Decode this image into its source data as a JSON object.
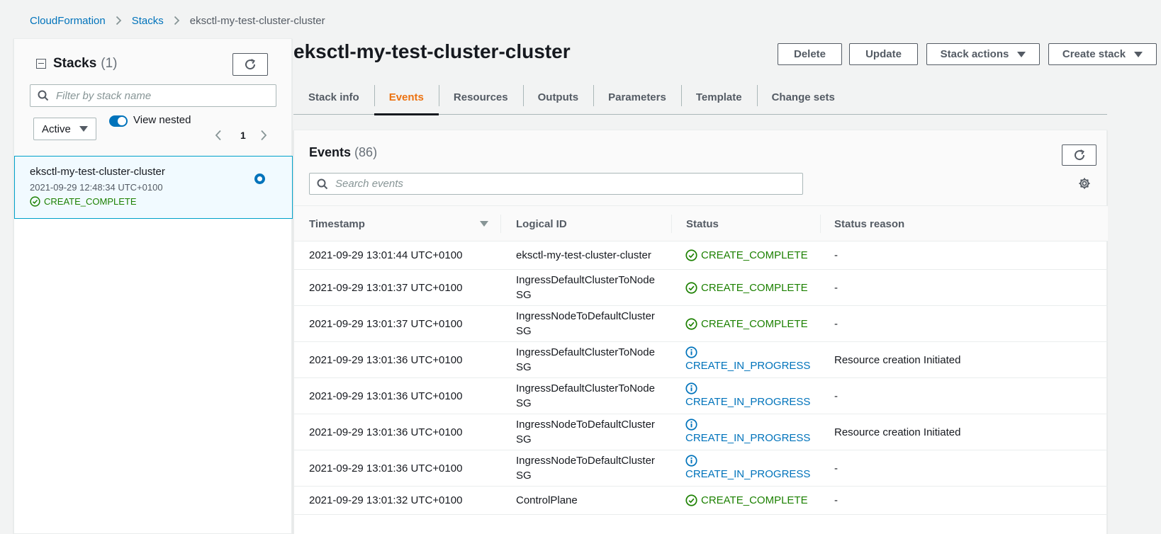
{
  "breadcrumb": {
    "root": "CloudFormation",
    "stacks": "Stacks",
    "current": "eksctl-my-test-cluster-cluster"
  },
  "left": {
    "title": "Stacks",
    "count": "(1)",
    "filter_placeholder": "Filter by stack name",
    "status_filter": "Active",
    "toggle_label": "View nested",
    "page": "1",
    "stack": {
      "name": "eksctl-my-test-cluster-cluster",
      "date": "2021-09-29 12:48:34 UTC+0100",
      "status": "CREATE_COMPLETE"
    }
  },
  "main": {
    "title": "eksctl-my-test-cluster-cluster",
    "buttons": {
      "delete": "Delete",
      "update": "Update",
      "stack_actions": "Stack actions",
      "create_stack": "Create stack"
    },
    "tabs": [
      "Stack info",
      "Events",
      "Resources",
      "Outputs",
      "Parameters",
      "Template",
      "Change sets"
    ],
    "active_tab": "Events"
  },
  "events": {
    "title": "Events",
    "count": "(86)",
    "search_placeholder": "Search events",
    "columns": {
      "timestamp": "Timestamp",
      "logical_id": "Logical ID",
      "status": "Status",
      "reason": "Status reason"
    },
    "rows": [
      {
        "timestamp": "2021-09-29 13:01:44 UTC+0100",
        "logical_id": "eksctl-my-test-cluster-cluster",
        "status": "CREATE_COMPLETE",
        "reason": "-"
      },
      {
        "timestamp": "2021-09-29 13:01:37 UTC+0100",
        "logical_id": "IngressDefaultClusterToNodeSG",
        "status": "CREATE_COMPLETE",
        "reason": "-"
      },
      {
        "timestamp": "2021-09-29 13:01:37 UTC+0100",
        "logical_id": "IngressNodeToDefaultClusterSG",
        "status": "CREATE_COMPLETE",
        "reason": "-"
      },
      {
        "timestamp": "2021-09-29 13:01:36 UTC+0100",
        "logical_id": "IngressDefaultClusterToNodeSG",
        "status": "CREATE_IN_PROGRESS",
        "reason": "Resource creation Initiated"
      },
      {
        "timestamp": "2021-09-29 13:01:36 UTC+0100",
        "logical_id": "IngressDefaultClusterToNodeSG",
        "status": "CREATE_IN_PROGRESS",
        "reason": "-"
      },
      {
        "timestamp": "2021-09-29 13:01:36 UTC+0100",
        "logical_id": "IngressNodeToDefaultClusterSG",
        "status": "CREATE_IN_PROGRESS",
        "reason": "Resource creation Initiated"
      },
      {
        "timestamp": "2021-09-29 13:01:36 UTC+0100",
        "logical_id": "IngressNodeToDefaultClusterSG",
        "status": "CREATE_IN_PROGRESS",
        "reason": "-"
      },
      {
        "timestamp": "2021-09-29 13:01:32 UTC+0100",
        "logical_id": "ControlPlane",
        "status": "CREATE_COMPLETE",
        "reason": "-"
      }
    ]
  },
  "colors": {
    "link": "#0073bb",
    "success": "#1d8102",
    "active_tab": "#ec7211",
    "selected_bg": "#f1faff"
  },
  "icons": {
    "refresh": "refresh-icon",
    "search": "search-icon",
    "settings": "gear-icon",
    "success": "check-circle-icon",
    "info": "info-circle-icon"
  }
}
